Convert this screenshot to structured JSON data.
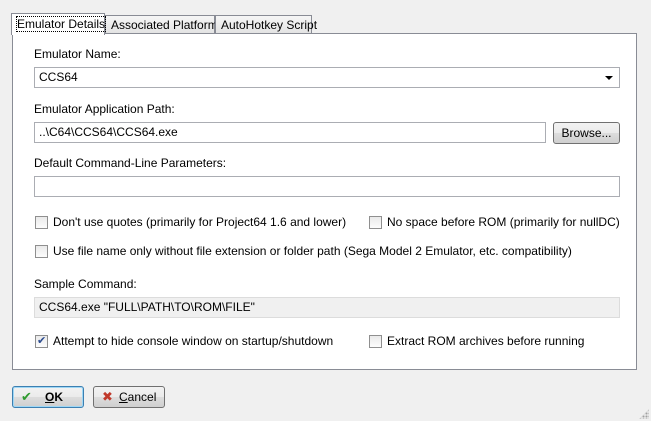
{
  "tabs": [
    {
      "label": "Emulator Details",
      "active": true
    },
    {
      "label": "Associated Platforms",
      "active": false
    },
    {
      "label": "AutoHotkey Script",
      "active": false
    }
  ],
  "emulator_name": {
    "label": "Emulator Name:",
    "value": "CCS64"
  },
  "app_path": {
    "label": "Emulator Application Path:",
    "value": "..\\C64\\CCS64\\CCS64.exe",
    "browse_label": "Browse..."
  },
  "params": {
    "label": "Default Command-Line Parameters:",
    "value": ""
  },
  "options": {
    "no_quotes": {
      "label": "Don't use quotes (primarily for Project64 1.6 and lower)",
      "checked": false
    },
    "no_space": {
      "label": "No space before ROM (primarily for nullDC)",
      "checked": false
    },
    "file_name_only": {
      "label": "Use file name only without file extension or folder path (Sega Model 2 Emulator, etc. compatibility)",
      "checked": false
    },
    "hide_console": {
      "label": "Attempt to hide console window on startup/shutdown",
      "checked": true
    },
    "extract_rom": {
      "label": "Extract ROM archives before running",
      "checked": false
    }
  },
  "sample": {
    "label": "Sample Command:",
    "value": "CCS64.exe \"FULL\\PATH\\TO\\ROM\\FILE\""
  },
  "buttons": {
    "ok_first": "O",
    "ok_rest": "K",
    "cancel_first": "C",
    "cancel_rest": "ancel"
  },
  "icons": {
    "ok": "check-icon",
    "cancel": "cross-icon"
  },
  "colors": {
    "ok_icon": "#2e9a2e",
    "cancel_icon": "#c0392b"
  }
}
